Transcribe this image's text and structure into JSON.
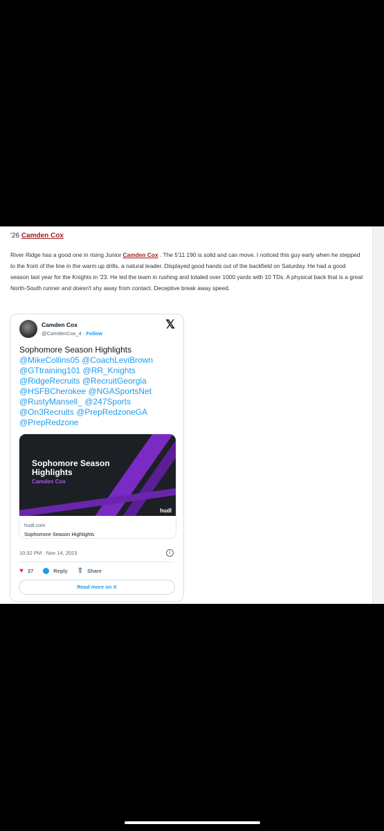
{
  "article": {
    "heading_prefix": "'26 ",
    "heading_name": "Camden Cox",
    "body_before": "River Ridge has a good one in rising Junior ",
    "body_name": "Camden Cox",
    "body_after": " . The 5'11 190 is solid and can move. I noticed this guy early when he stepped to the front of the line in the warm up drills, a natural leader. Displayed good hands out of the backfield on Saturday. He had a good season last year for the Knights in '23. He led the team in rushing and totaled over 1000 yards with 10 TDs. A physical back that is a great North-South runner and doesn't shy away from contact. Deceptive break away speed."
  },
  "tweet": {
    "author_name": "Camden Cox",
    "handle": "@CamdenCox_4",
    "separator": " · ",
    "follow_label": "Follow",
    "platform_icon": "x-logo",
    "text_title": "Sophomore Season Highlights",
    "mention_lines": [
      "@MikeCollins05 @CoachLeviBrown",
      "@GTtraining101 @RR_Knights",
      "@RidgeRecruits @RecruitGeorgia",
      "@HSFBCherokee @NGASportsNet",
      "@RustyMansell_ @247Sports",
      "@On3Recruits @PrepRedzoneGA",
      "@PrepRedzone"
    ],
    "card": {
      "title": "Sophomore Season Highlights",
      "subtitle": "Camden Cox",
      "brand": "hudl",
      "domain": "hudl.com",
      "link_title": "Sophomore Season Highlights"
    },
    "timestamp": "10:32 PM · Nov 14, 2023",
    "info_icon": "i",
    "likes": "27",
    "reply_label": "Reply",
    "share_label": "Share",
    "read_more": "Read more on X"
  },
  "colors": {
    "link_red": "#9b1c1c",
    "twitter_blue": "#1d9bf0",
    "heart_pink": "#f91880",
    "card_purple": "#7a2bc4"
  }
}
